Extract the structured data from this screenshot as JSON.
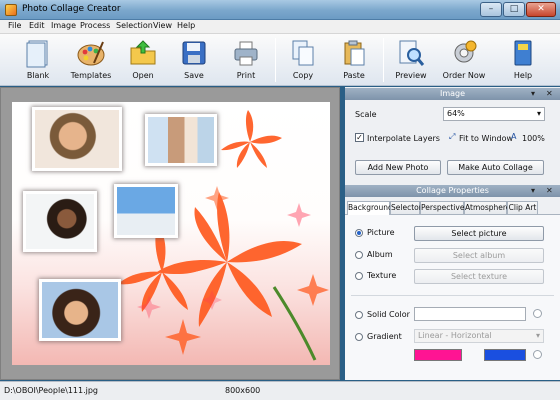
{
  "window": {
    "title": "Photo Collage Creator",
    "controls": {
      "minimize": "–",
      "maximize": "□",
      "close": "✕"
    }
  },
  "menu": [
    "File",
    "Edit",
    "Image",
    "Process",
    "Selection",
    "View",
    "Help"
  ],
  "toolbar": {
    "buttons": [
      {
        "label": "Blank",
        "icon": "blank-document-icon"
      },
      {
        "label": "Templates",
        "icon": "palette-icon"
      },
      {
        "label": "Open",
        "icon": "open-folder-icon"
      },
      {
        "label": "Save",
        "icon": "floppy-disk-icon"
      },
      {
        "label": "Print",
        "icon": "printer-icon"
      },
      {
        "label": "Copy",
        "icon": "copy-icon"
      },
      {
        "label": "Paste",
        "icon": "paste-icon"
      },
      {
        "label": "Preview",
        "icon": "magnifier-preview-icon"
      },
      {
        "label": "Order Now",
        "icon": "order-gear-icon"
      },
      {
        "label": "Help",
        "icon": "help-book-icon"
      }
    ]
  },
  "image_panel": {
    "title": "Image",
    "scale_label": "Scale",
    "scale_value": "64%",
    "interpolate_label": "Interpolate Layers",
    "interpolate_checked": true,
    "fit_label": "Fit to Window",
    "hundred_label": "100%",
    "add_photo": "Add New Photo",
    "auto_collage": "Make Auto Collage"
  },
  "props_panel": {
    "title": "Collage Properties",
    "tabs": [
      "Background",
      "Selector",
      "Perspective",
      "Atmosphere",
      "Clip Art"
    ],
    "active_tab": "Background",
    "picture_label": "Picture",
    "select_picture": "Select picture",
    "album_label": "Album",
    "select_album": "Select album",
    "texture_label": "Texture",
    "select_texture": "Select texture",
    "solid_label": "Solid Color",
    "gradient_label": "Gradient",
    "gradient_value": "Linear - Horizontal",
    "gradient_color_1": "#ff1493",
    "gradient_color_2": "#1a4fe0"
  },
  "status": {
    "path": "D:\\OBOI\\People\\111.jpg",
    "size": "800x600"
  }
}
